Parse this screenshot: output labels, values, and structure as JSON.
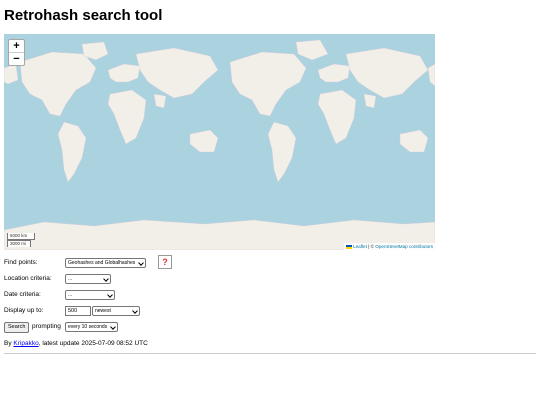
{
  "page": {
    "title": "Retrohash search tool"
  },
  "map": {
    "zoom_in": "+",
    "zoom_out": "−",
    "scale_km": "5000 km",
    "scale_mi": "3000 mi",
    "attribution_leaflet": "Leaflet",
    "attribution_sep": " | © ",
    "attribution_osm": "OpenStreetMap contributors",
    "colors": {
      "water": "#aad3df",
      "land": "#f2efe9"
    }
  },
  "form": {
    "find_points": {
      "label": "Find points:",
      "value": "Geohashes and Globalhashes",
      "help_icon": "?"
    },
    "location": {
      "label": "Location criteria:",
      "value": "..."
    },
    "date": {
      "label": "Date criteria:",
      "value": "..."
    },
    "display": {
      "label": "Display up to:",
      "count": "500",
      "order": "newest"
    },
    "search": {
      "button": "Search",
      "prompting": "prompting",
      "interval": "every 10 seconds"
    }
  },
  "footer": {
    "prefix": "By ",
    "author": "Kripakko",
    "suffix": ", latest update 2025-07-09 08:52 UTC"
  }
}
